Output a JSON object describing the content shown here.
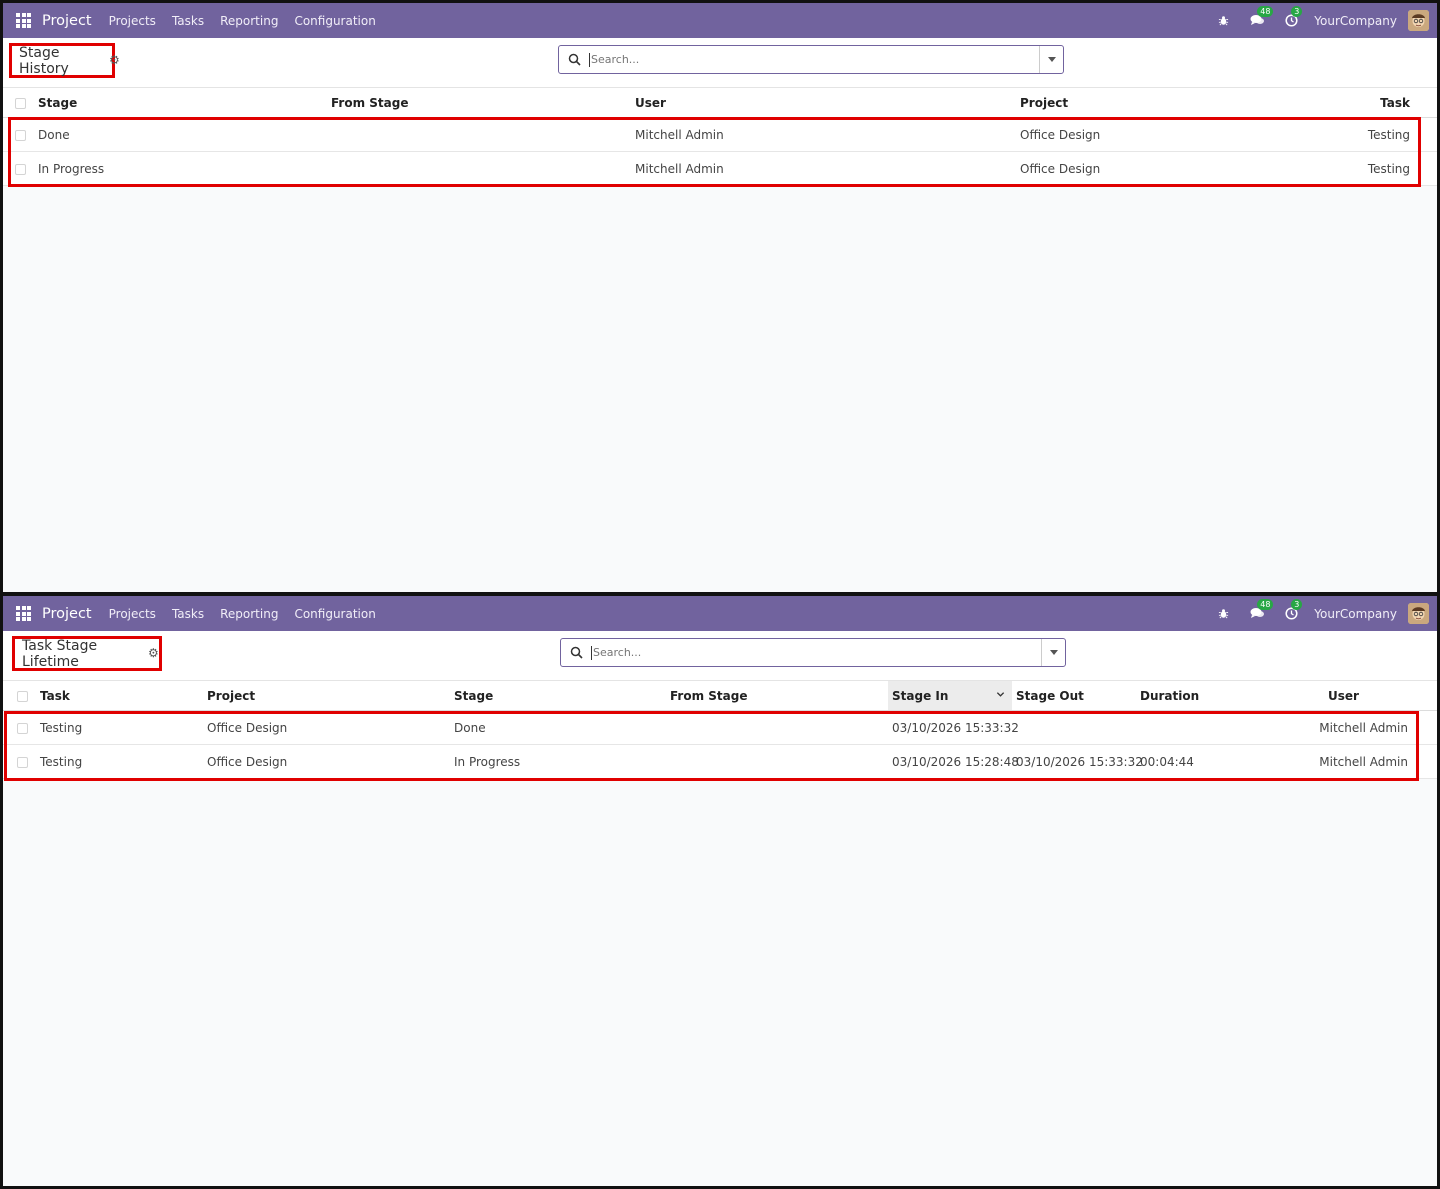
{
  "screens": [
    {
      "navbar": {
        "app_name": "Project",
        "menu": [
          "Projects",
          "Tasks",
          "Reporting",
          "Configuration"
        ],
        "messages_badge": "48",
        "activities_badge": "3",
        "company": "YourCompany"
      },
      "control": {
        "title": "Stage History",
        "search_placeholder": "Search..."
      },
      "table": {
        "headers": [
          "Stage",
          "From Stage",
          "User",
          "Project",
          "Task"
        ],
        "rows": [
          [
            "Done",
            "",
            "Mitchell Admin",
            "Office Design",
            "Testing"
          ],
          [
            "In Progress",
            "",
            "Mitchell Admin",
            "Office Design",
            "Testing"
          ]
        ]
      }
    },
    {
      "navbar": {
        "app_name": "Project",
        "menu": [
          "Projects",
          "Tasks",
          "Reporting",
          "Configuration"
        ],
        "messages_badge": "48",
        "activities_badge": "3",
        "company": "YourCompany"
      },
      "control": {
        "title": "Task Stage Lifetime",
        "search_placeholder": "Search..."
      },
      "table": {
        "headers": [
          "Task",
          "Project",
          "Stage",
          "From Stage",
          "Stage In",
          "Stage Out",
          "Duration",
          "User"
        ],
        "sorted_column": "Stage In",
        "rows": [
          [
            "Testing",
            "Office Design",
            "Done",
            "",
            "03/10/2026 15:33:32",
            "",
            "",
            "Mitchell Admin"
          ],
          [
            "Testing",
            "Office Design",
            "In Progress",
            "",
            "03/10/2026 15:28:48",
            "03/10/2026 15:33:32",
            "00:04:44",
            "Mitchell Admin"
          ]
        ]
      }
    }
  ],
  "colors": {
    "navbar": "#71639e",
    "highlight": "#e00000",
    "badge": "#28a745"
  }
}
